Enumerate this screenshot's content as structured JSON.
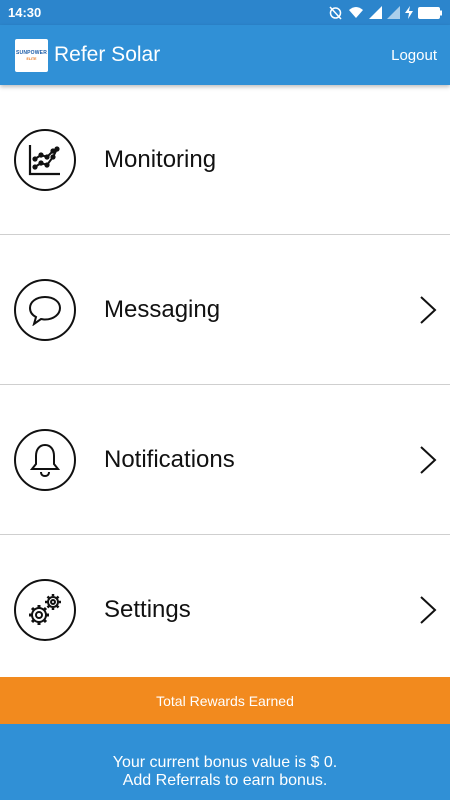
{
  "status_bar": {
    "time": "14:30",
    "icons": [
      "alarm-off-icon",
      "wifi-icon",
      "signal-icon",
      "signal-icon",
      "charging-icon",
      "battery-icon"
    ]
  },
  "app_bar": {
    "logo_text_top": "SUNPOWER",
    "logo_text_bottom": "ELITE",
    "title": "Refer Solar",
    "logout_label": "Logout",
    "background": "#3090d6"
  },
  "menu": {
    "items": [
      {
        "label": "Monitoring",
        "icon": "chart-icon",
        "has_chevron": false
      },
      {
        "label": "Messaging",
        "icon": "chat-bubble-icon",
        "has_chevron": true
      },
      {
        "label": "Notifications",
        "icon": "bell-icon",
        "has_chevron": true
      },
      {
        "label": "Settings",
        "icon": "gears-icon",
        "has_chevron": true
      }
    ]
  },
  "rewards": {
    "label": "Total Rewards Earned",
    "color": "#f28a1e"
  },
  "bonus": {
    "line1": "Your current bonus value is $ 0.",
    "line2": "Add Referrals to earn bonus."
  }
}
